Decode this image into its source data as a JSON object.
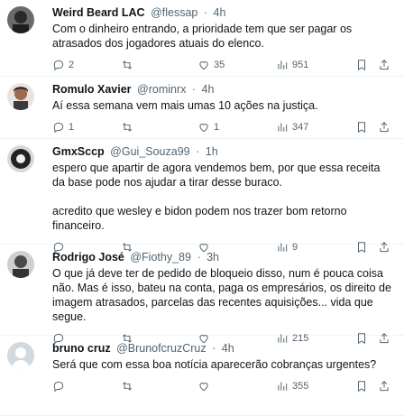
{
  "tweets": [
    {
      "name": "Weird Beard LAC",
      "handle": "@flessap",
      "time": "4h",
      "text": [
        "Com o dinheiro entrando, a prioridade tem que ser pagar os atrasados dos jogadores atuais do elenco."
      ],
      "replies": "2",
      "retweets": "",
      "likes": "35",
      "views": "951",
      "avatar_color": "#3a3a3a"
    },
    {
      "name": "Romulo Xavier",
      "handle": "@rominrx",
      "time": "4h",
      "text": [
        "Aí essa semana vem mais umas 10 ações na justiça."
      ],
      "replies": "1",
      "retweets": "",
      "likes": "1",
      "views": "347",
      "avatar_color": "#8a6f5c"
    },
    {
      "name": "GmxSccp",
      "handle": "@Gui_Souza99",
      "time": "1h",
      "text": [
        "espero que apartir de agora vendemos bem, por que essa receita da base pode nos ajudar a tirar desse buraco.",
        "acredito que wesley e bidon podem nos trazer bom retorno financeiro."
      ],
      "replies": "",
      "retweets": "",
      "likes": "",
      "views": "9",
      "avatar_color": "#2b2b2b"
    },
    {
      "name": "Rodrigo José",
      "handle": "@Fiothy_89",
      "time": "3h",
      "text": [
        "O que já deve ter de pedido de bloqueio disso, num é pouca coisa não. Mas é isso, bateu na conta, paga os empresários, os direito de imagem atrasados, parcelas das recentes aquisições... vida que segue."
      ],
      "replies": "",
      "retweets": "",
      "likes": "",
      "views": "215",
      "avatar_color": "#555555"
    },
    {
      "name": "bruno cruz",
      "handle": "@BrunofcruzCruz",
      "time": "4h",
      "text": [
        "Será que com essa boa notícia aparecerão cobranças urgentes?"
      ],
      "replies": "",
      "retweets": "",
      "likes": "",
      "views": "355",
      "avatar_color": "#cfd9de"
    }
  ]
}
